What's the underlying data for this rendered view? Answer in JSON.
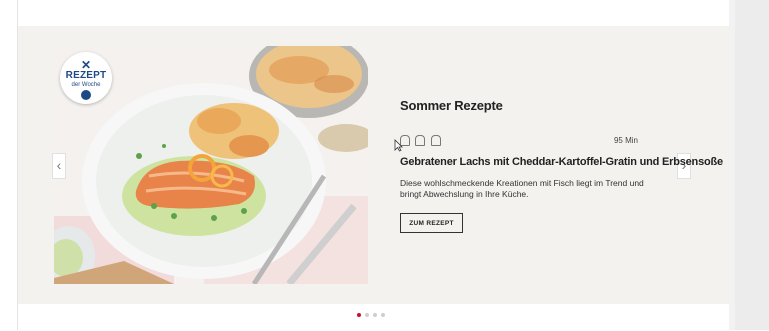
{
  "badge": {
    "line1": "REZEPT",
    "line2": "der Woche"
  },
  "teaser": {
    "category": "Sommer Rezepte",
    "time": "95 Min",
    "difficulty_level": 1,
    "difficulty_max": 3,
    "recipe_title": "Gebratener Lachs mit Cheddar-Kartoffel-Gratin und Erbsensoße",
    "description": "Diese wohlschmeckende Kreationen mit Fisch liegt im Trend und bringt Abwechslung in Ihre Küche.",
    "button_label": "ZUM REZEPT"
  },
  "carousel": {
    "prev_glyph": "‹",
    "next_glyph": "›",
    "slide_count": 4,
    "active_index": 0
  },
  "colors": {
    "accent": "#c8102e",
    "panel": "#f3f2ef",
    "badge_blue": "#1d4a86",
    "salmon": "#e8834a"
  }
}
